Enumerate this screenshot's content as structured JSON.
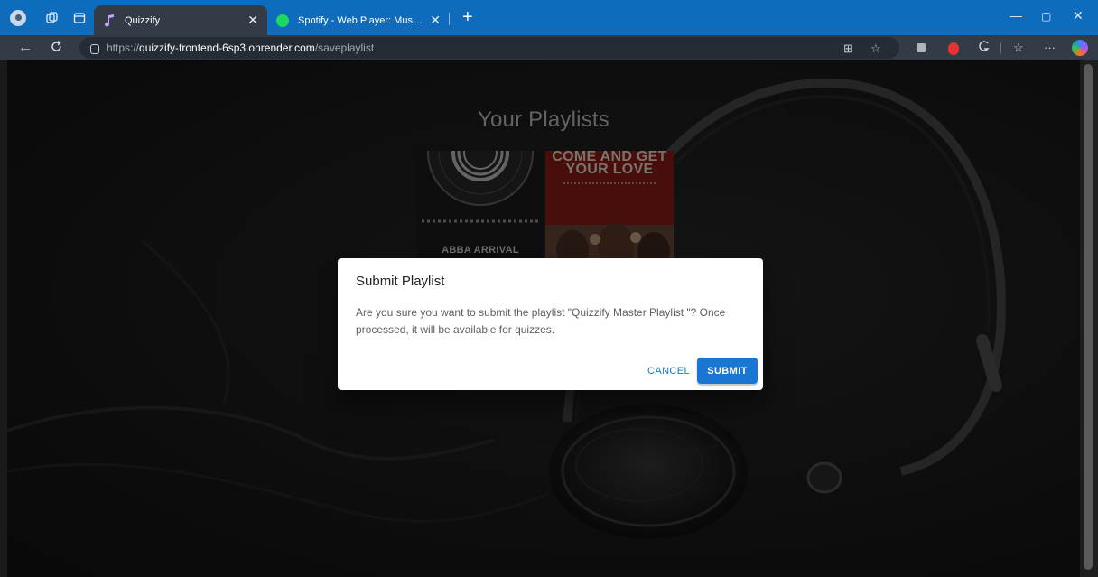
{
  "browser": {
    "tabs": [
      {
        "title": "Quizzify",
        "active": true
      },
      {
        "title": "Spotify - Web Player: Music for every",
        "active": false
      }
    ],
    "url": {
      "protocol": "https://",
      "host": "quizzify-frontend-6sp3.onrender.com",
      "path": "/saveplaylist"
    },
    "icons": [
      "profile-icon",
      "collections-icon",
      "workspaces-icon",
      "back-icon",
      "refresh-icon",
      "lock-icon",
      "split-screen-icon",
      "favorite-icon",
      "extension-icon",
      "adblock-icon",
      "browser-essentials-icon",
      "favorites-bar-icon",
      "more-icon",
      "copilot-icon"
    ]
  },
  "page": {
    "title": "Your Playlists",
    "covers": [
      {
        "label": "ABBA ARRIVAL"
      },
      {
        "label": "COME AND GET YOUR LOVE"
      }
    ]
  },
  "dialog": {
    "title": "Submit Playlist",
    "message": "Are you sure you want to submit the playlist \"Quizzify Master Playlist \"? Once processed, it will be available for quizzes.",
    "cancel_label": "CANCEL",
    "submit_label": "SUBMIT"
  },
  "colors": {
    "browser_accent": "#0f6cbd",
    "primary_button": "#1976d2"
  }
}
